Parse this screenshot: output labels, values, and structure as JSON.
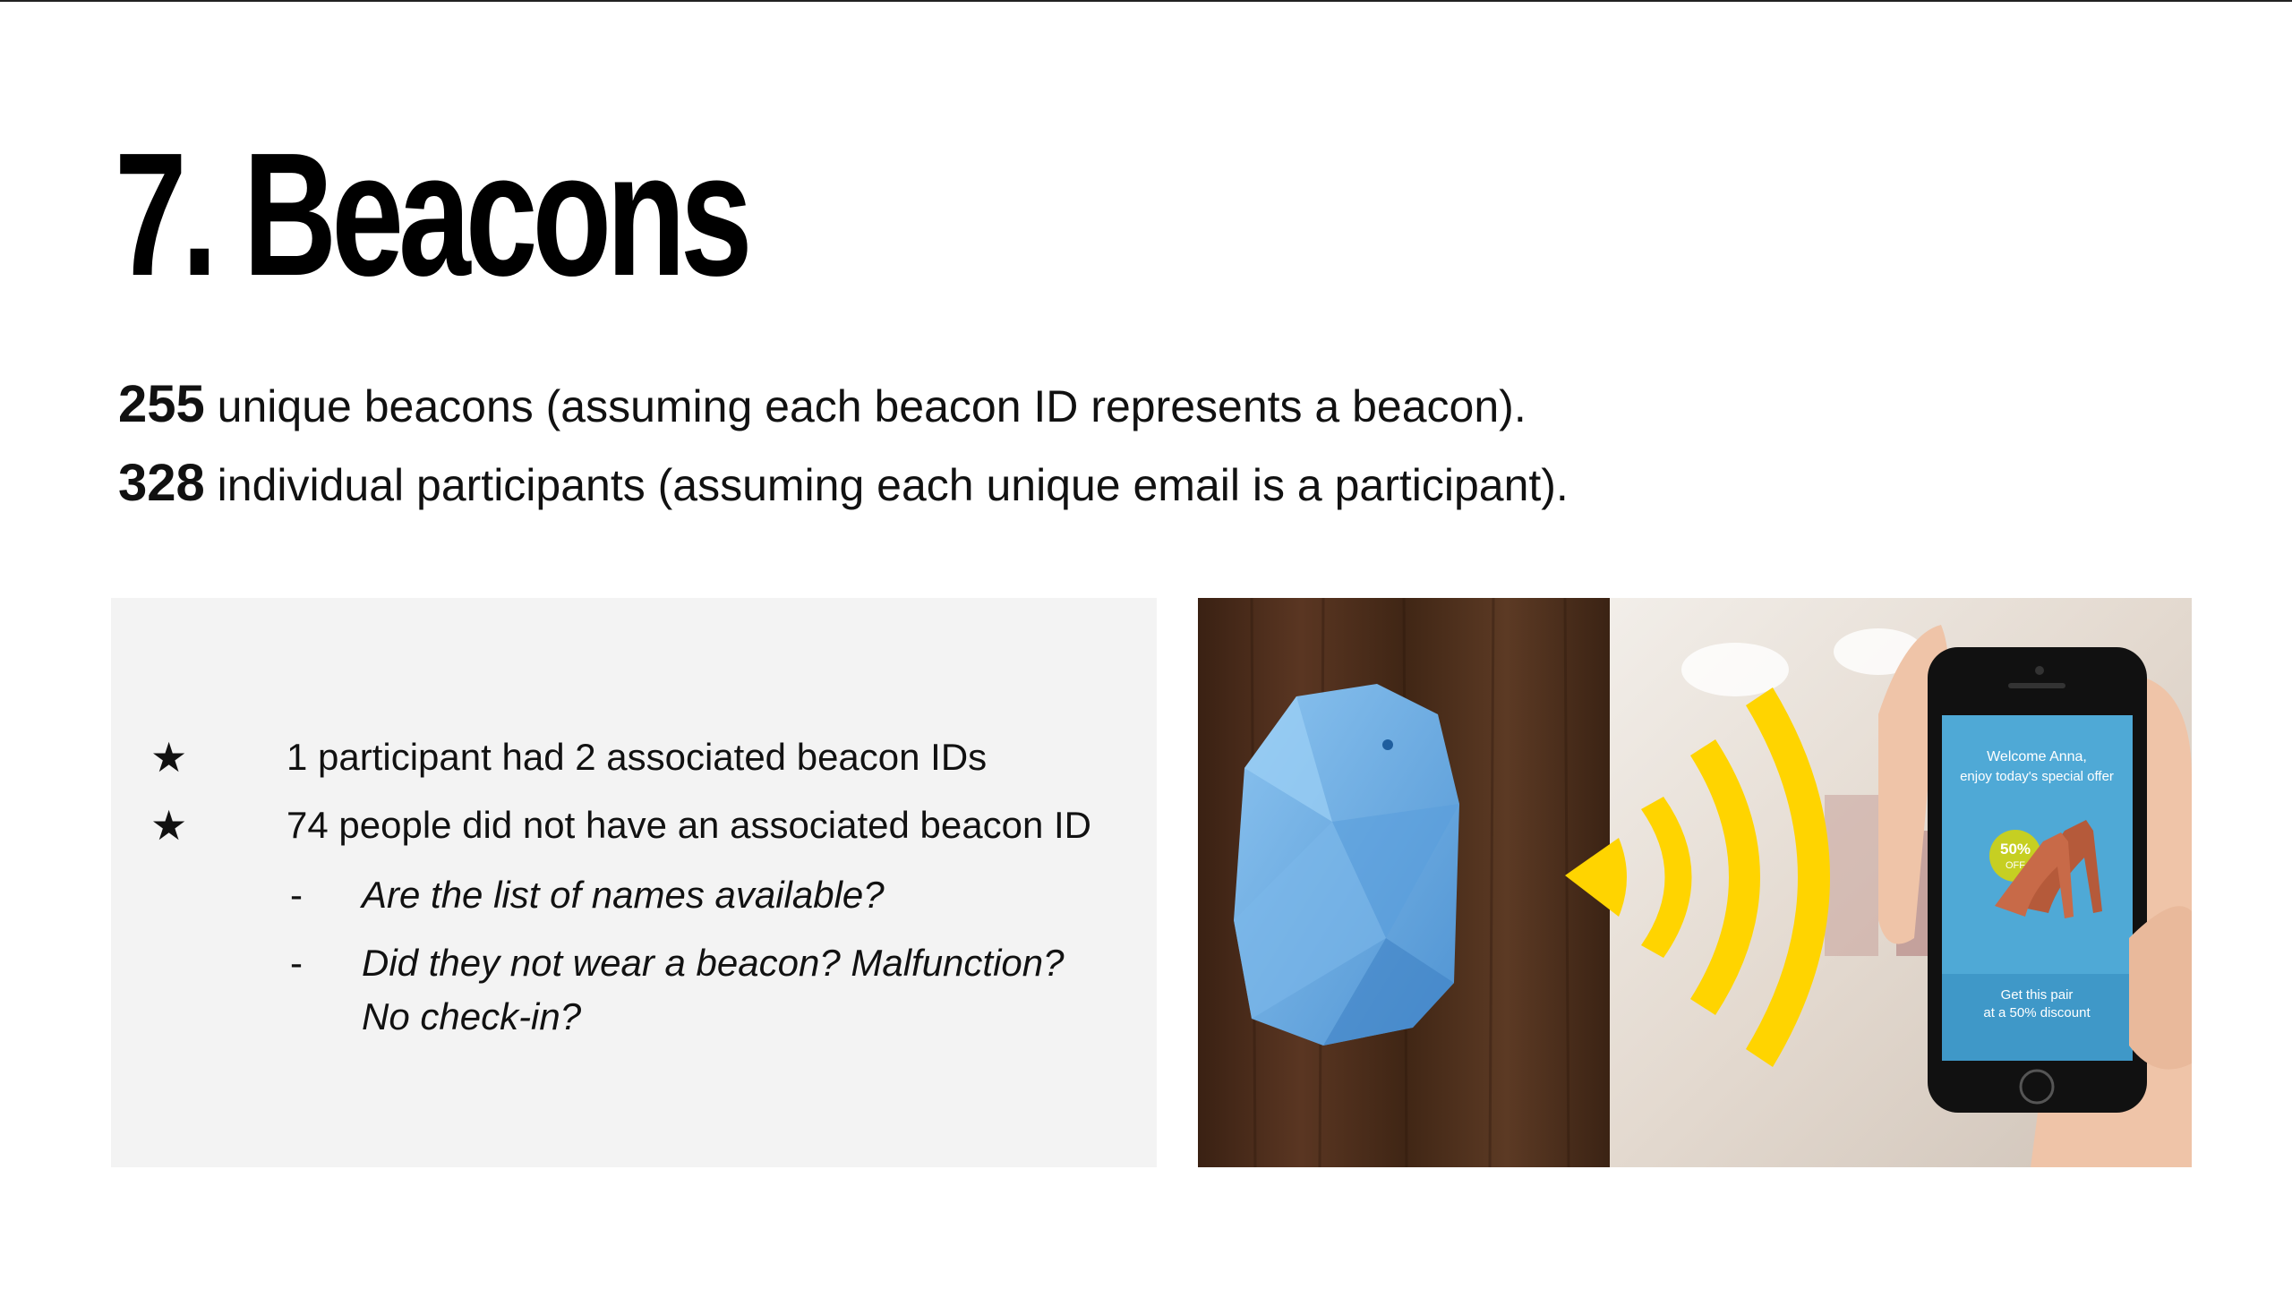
{
  "slide": {
    "title": "7. Beacons",
    "stats": [
      {
        "number": "255",
        "text": " unique beacons (assuming each beacon ID represents a beacon)."
      },
      {
        "number": "328",
        "text": " individual participants (assuming each unique email is a participant)."
      }
    ]
  },
  "notes": {
    "bullets": [
      {
        "marker": "★",
        "text": "1 participant had 2 associated beacon IDs"
      },
      {
        "marker": "★",
        "text": "74 people did not have an associated beacon ID"
      }
    ],
    "sub_bullets": [
      {
        "marker": "-",
        "text": "Are the list of names available?"
      },
      {
        "marker": "-",
        "text": "Did they not wear a beacon? Malfunction? No check-in?"
      }
    ]
  },
  "photo": {
    "phone_screen": {
      "welcome": "Welcome Anna,",
      "offer": "enjoy today's special offer",
      "badge_pct": "50%",
      "badge_off": "OFF",
      "cta_line1": "Get this pair",
      "cta_line2": "at a 50% discount"
    },
    "colors": {
      "beacon": "#6aaee6",
      "signal": "#ffd400",
      "wood": "#4a2c1a",
      "screen": "#4fa9d6"
    }
  }
}
